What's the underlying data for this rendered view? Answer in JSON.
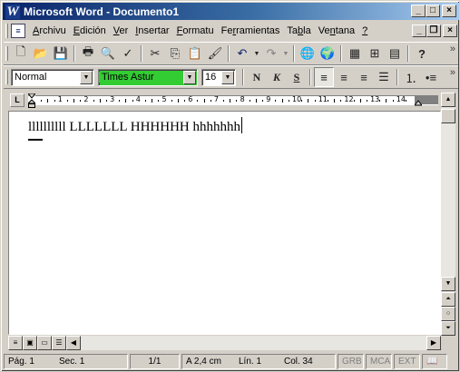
{
  "window": {
    "title": "Microsoft Word - Documento1",
    "app_icon": "W"
  },
  "caption_buttons": [
    "_",
    "□",
    "×"
  ],
  "menu": {
    "items": [
      {
        "prefix": "",
        "accel": "A",
        "rest": "rchivu"
      },
      {
        "prefix": "",
        "accel": "E",
        "rest": "dición"
      },
      {
        "prefix": "",
        "accel": "V",
        "rest": "er"
      },
      {
        "prefix": "",
        "accel": "I",
        "rest": "nsertar"
      },
      {
        "prefix": "",
        "accel": "F",
        "rest": "ormatu"
      },
      {
        "prefix": "Fe",
        "accel": "r",
        "rest": "ramientas"
      },
      {
        "prefix": "Ta",
        "accel": "b",
        "rest": "la"
      },
      {
        "prefix": "Ve",
        "accel": "n",
        "rest": "tana"
      },
      {
        "prefix": "",
        "accel": "?",
        "rest": ""
      }
    ]
  },
  "toolbar_standard": {
    "icons": [
      "new-icon",
      "open-icon",
      "save-icon",
      "print-icon",
      "print-preview-icon",
      "spelling-icon",
      "cut-icon",
      "copy-icon",
      "paste-icon",
      "format-painter-icon",
      "undo-icon",
      "redo-icon",
      "hyperlink-icon",
      "web-toolbar-icon",
      "tables-borders-icon",
      "insert-table-icon",
      "insert-excel-icon",
      "help-icon"
    ]
  },
  "toolbar_format": {
    "style": "Normal",
    "font": "Times Astur",
    "size": "16",
    "bold": "N",
    "italic": "K",
    "underline": "S"
  },
  "ruler": {
    "labels": [
      "1",
      "2",
      "3",
      "4",
      "5",
      "6",
      "7",
      "8",
      "9",
      "10",
      "11",
      "12",
      "13",
      "14"
    ]
  },
  "document": {
    "text": "llllllllll LLLLLLL HHHHHH hhhhhhh"
  },
  "status": {
    "page": "Pág.  1",
    "section": "Sec.  1",
    "pages": "1/1",
    "at": "A  2,4 cm",
    "line": "Lín.  1",
    "col": "Col.  34",
    "rec": "GRB",
    "trk": "MCA",
    "ext": "EXT"
  },
  "colors": {
    "title_start": "#0a246a",
    "title_end": "#a6caf0",
    "font_highlight": "#33cc33",
    "chrome": "#d4d0c8"
  }
}
